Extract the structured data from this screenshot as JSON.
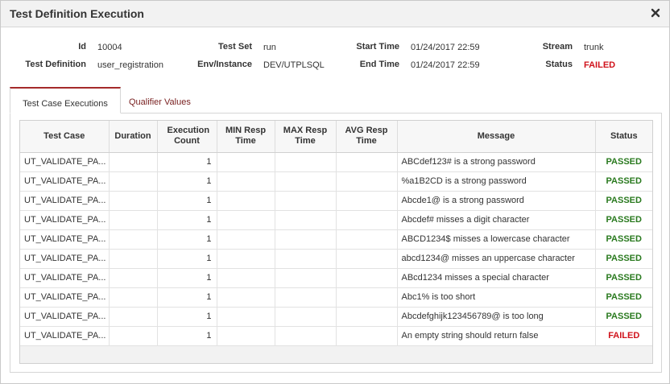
{
  "dialog": {
    "title": "Test Definition Execution"
  },
  "info": {
    "id_label": "Id",
    "id_value": "10004",
    "testdef_label": "Test Definition",
    "testdef_value": "user_registration",
    "testset_label": "Test Set",
    "testset_value": "run",
    "env_label": "Env/Instance",
    "env_value": "DEV/UTPLSQL",
    "start_label": "Start Time",
    "start_value": "01/24/2017 22:59",
    "end_label": "End Time",
    "end_value": "01/24/2017 22:59",
    "stream_label": "Stream",
    "stream_value": "trunk",
    "status_label": "Status",
    "status_value": "FAILED"
  },
  "tabs": [
    {
      "label": "Test Case Executions",
      "active": true
    },
    {
      "label": "Qualifier Values",
      "active": false
    }
  ],
  "table": {
    "headers": [
      "Test Case",
      "Duration",
      "Execution Count",
      "MIN Resp Time",
      "MAX Resp Time",
      "AVG Resp Time",
      "Message",
      "Status"
    ],
    "rows": [
      {
        "test_case": "UT_VALIDATE_PA...",
        "duration": "",
        "count": "1",
        "min": "",
        "max": "",
        "avg": "",
        "message": "ABCdef123# is a strong password",
        "status": "PASSED"
      },
      {
        "test_case": "UT_VALIDATE_PA...",
        "duration": "",
        "count": "1",
        "min": "",
        "max": "",
        "avg": "",
        "message": "%a1B2CD is a strong password",
        "status": "PASSED"
      },
      {
        "test_case": "UT_VALIDATE_PA...",
        "duration": "",
        "count": "1",
        "min": "",
        "max": "",
        "avg": "",
        "message": "Abcde1@ is a strong password",
        "status": "PASSED"
      },
      {
        "test_case": "UT_VALIDATE_PA...",
        "duration": "",
        "count": "1",
        "min": "",
        "max": "",
        "avg": "",
        "message": "Abcdef# misses a digit character",
        "status": "PASSED"
      },
      {
        "test_case": "UT_VALIDATE_PA...",
        "duration": "",
        "count": "1",
        "min": "",
        "max": "",
        "avg": "",
        "message": "ABCD1234$ misses a lowercase character",
        "status": "PASSED"
      },
      {
        "test_case": "UT_VALIDATE_PA...",
        "duration": "",
        "count": "1",
        "min": "",
        "max": "",
        "avg": "",
        "message": "abcd1234@ misses an uppercase character",
        "status": "PASSED"
      },
      {
        "test_case": "UT_VALIDATE_PA...",
        "duration": "",
        "count": "1",
        "min": "",
        "max": "",
        "avg": "",
        "message": "ABcd1234 misses a special character",
        "status": "PASSED"
      },
      {
        "test_case": "UT_VALIDATE_PA...",
        "duration": "",
        "count": "1",
        "min": "",
        "max": "",
        "avg": "",
        "message": "Abc1% is too short",
        "status": "PASSED"
      },
      {
        "test_case": "UT_VALIDATE_PA...",
        "duration": "",
        "count": "1",
        "min": "",
        "max": "",
        "avg": "",
        "message": "Abcdefghijk123456789@ is too long",
        "status": "PASSED"
      },
      {
        "test_case": "UT_VALIDATE_PA...",
        "duration": "",
        "count": "1",
        "min": "",
        "max": "",
        "avg": "",
        "message": "An empty string should return false",
        "status": "FAILED"
      }
    ]
  },
  "icons": {
    "close": "close-icon"
  },
  "colors": {
    "passed": "#2a7a1f",
    "failed": "#d0121b",
    "tab_accent": "#a52a2a"
  }
}
